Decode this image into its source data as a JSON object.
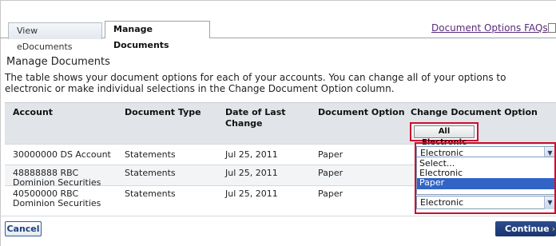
{
  "tabs": [
    {
      "label": "View eDocuments"
    },
    {
      "label": "Manage Documents"
    }
  ],
  "faq_link": "Document Options FAQs",
  "section_title": "Manage Documents",
  "description": "The table shows your document options for each of your accounts. You can change all of your options to electronic or make individual selections in the Change Document Option column.",
  "table": {
    "headers": [
      "Account",
      "Document Type",
      "Date of Last Change",
      "Document Option",
      "Change Document Option"
    ],
    "all_electronic_button": "All Electronic",
    "rows": [
      {
        "account": "30000000 DS Account",
        "doc_type": "Statements",
        "date": "Jul 25, 2011",
        "option": "Paper",
        "selected": "Electronic"
      },
      {
        "account": "48888888 RBC Dominion Securities",
        "doc_type": "Statements",
        "date": "Jul 25, 2011",
        "option": "Paper",
        "selected": ""
      },
      {
        "account": "40500000 RBC Dominion Securities",
        "doc_type": "Statements",
        "date": "Jul 25, 2011",
        "option": "Paper",
        "selected": "Electronic"
      }
    ],
    "dropdown_options": [
      "Select...",
      "Electronic",
      "Paper"
    ],
    "dropdown_highlighted": "Paper"
  },
  "buttons": {
    "cancel": "Cancel",
    "continue": "Continue"
  },
  "colors": {
    "highlight_red": "#c8102e",
    "primary_blue": "#1a3470",
    "link_purple": "#5a2a7a",
    "selected_option": "#3164c6"
  }
}
